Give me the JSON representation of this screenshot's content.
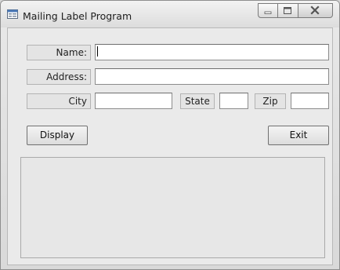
{
  "window": {
    "title": "Mailing Label Program"
  },
  "labels": {
    "name": "Name:",
    "address": "Address:",
    "city": "City",
    "state": "State",
    "zip": "Zip"
  },
  "inputs": {
    "name": "",
    "address": "",
    "city": "",
    "state": "",
    "zip": ""
  },
  "buttons": {
    "display": "Display",
    "exit": "Exit"
  },
  "output": {
    "text": ""
  },
  "icons": {
    "app": "form-window-icon",
    "minimize": "minimize-icon",
    "maximize": "maximize-icon",
    "close": "close-icon"
  }
}
